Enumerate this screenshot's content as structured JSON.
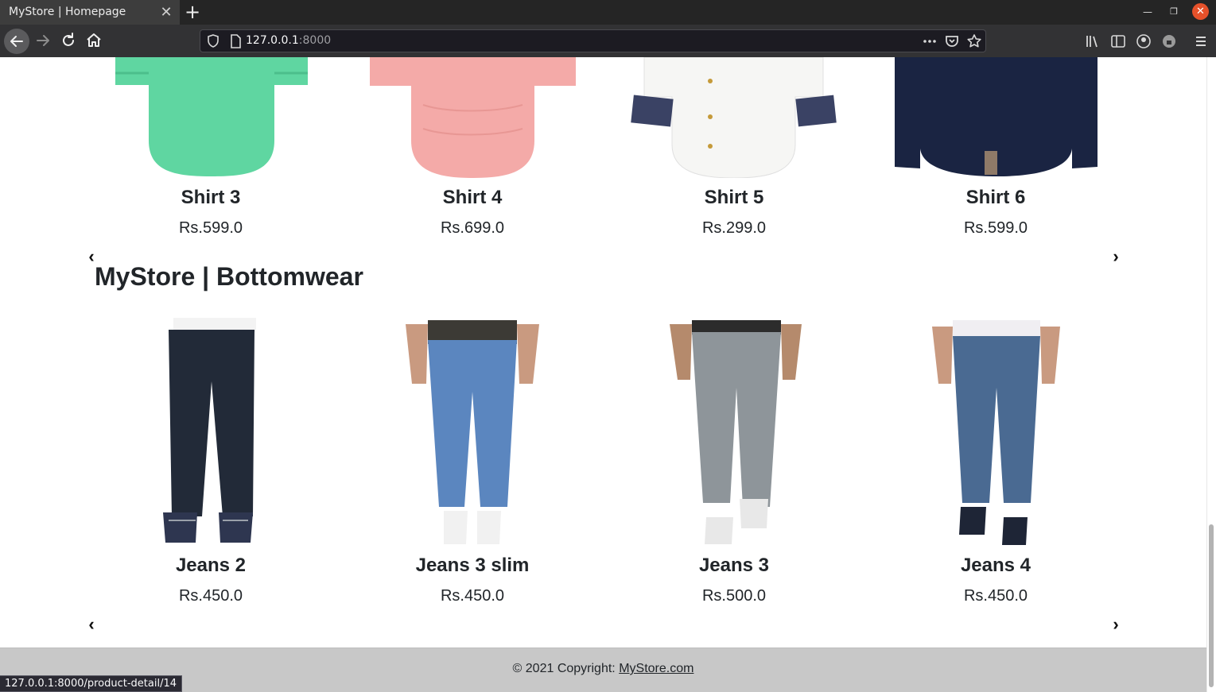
{
  "browser": {
    "tab_title": "MyStore | Homepage",
    "tab_close": "✕",
    "new_tab": "+",
    "url_host": "127.0.0.1",
    "url_port": ":8000",
    "status_url": "127.0.0.1:8000/product-detail/14"
  },
  "topwear": {
    "items": [
      {
        "name": "Shirt 3",
        "price": "Rs.599.0",
        "color": "#5fd6a1"
      },
      {
        "name": "Shirt 4",
        "price": "Rs.699.0",
        "color": "#f4aaa8"
      },
      {
        "name": "Shirt 5",
        "price": "Rs.299.0",
        "color": "#f6f6f4"
      },
      {
        "name": "Shirt 6",
        "price": "Rs.599.0",
        "color": "#1a2442"
      }
    ],
    "prev": "‹",
    "next": "›"
  },
  "bottomwear": {
    "title": "MyStore | Bottomwear",
    "items": [
      {
        "name": "Jeans 2",
        "price": "Rs.450.0",
        "color": "#222a38"
      },
      {
        "name": "Jeans 3 slim",
        "price": "Rs.450.0",
        "color": "#5b86bf"
      },
      {
        "name": "Jeans 3",
        "price": "Rs.500.0",
        "color": "#8e959a"
      },
      {
        "name": "Jeans 4",
        "price": "Rs.450.0",
        "color": "#4a6a92"
      }
    ],
    "prev": "‹",
    "next": "›"
  },
  "footer": {
    "copyright": "© 2021 Copyright: ",
    "link": "MyStore.com"
  }
}
